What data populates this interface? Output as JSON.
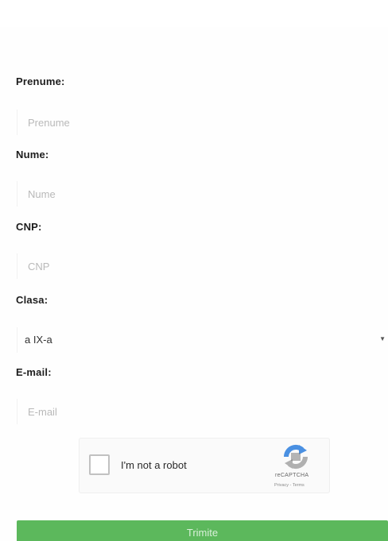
{
  "form": {
    "prenume": {
      "label": "Prenume:",
      "placeholder": "Prenume",
      "value": ""
    },
    "nume": {
      "label": "Nume:",
      "placeholder": "Nume",
      "value": ""
    },
    "cnp": {
      "label": "CNP:",
      "placeholder": "CNP",
      "value": ""
    },
    "clasa": {
      "label": "Clasa:",
      "selected": "a IX-a"
    },
    "email": {
      "label": "E-mail:",
      "placeholder": "E-mail",
      "value": ""
    }
  },
  "captcha": {
    "label": "I'm not a robot",
    "brand": "reCAPTCHA",
    "links": "Privacy - Terms",
    "logo_icon": "recaptcha-logo-icon",
    "checked": false
  },
  "submit": {
    "label": "Trimite"
  },
  "colors": {
    "submit_bg": "#5cb85c",
    "submit_text": "#d9f0d9",
    "captcha_blue": "#4a90e2",
    "captcha_grey": "#b0b0b0"
  }
}
